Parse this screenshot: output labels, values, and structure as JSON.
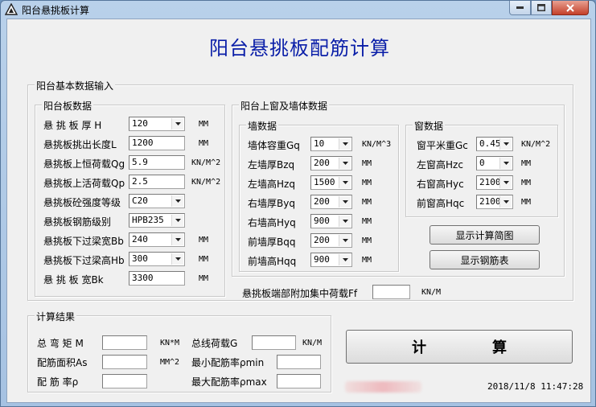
{
  "window": {
    "title": "阳台悬挑板计算"
  },
  "main_title": "阳台悬挑板配筋计算",
  "basic_group": {
    "legend": "阳台基本数据输入",
    "slab": {
      "legend": "阳台板数据",
      "rows": [
        {
          "label": "悬 挑 板 厚 H",
          "value": "120",
          "combo": true,
          "unit": "MM"
        },
        {
          "label": "悬挑板挑出长度L",
          "value": "1200",
          "combo": false,
          "unit": "MM"
        },
        {
          "label": "悬挑板上恒荷载Qg",
          "value": "5.9",
          "combo": false,
          "unit": "KN/M^2"
        },
        {
          "label": "悬挑板上活荷载Qp",
          "value": "2.5",
          "combo": false,
          "unit": "KN/M^2"
        },
        {
          "label": "悬挑板砼强度等级",
          "value": "C20",
          "combo": true,
          "unit": ""
        },
        {
          "label": "悬挑板钢筋级别",
          "value": "HPB235",
          "combo": true,
          "unit": ""
        },
        {
          "label": "悬挑板下过梁宽Bb",
          "value": "240",
          "combo": true,
          "unit": "MM"
        },
        {
          "label": "悬挑板下过梁高Hb",
          "value": "300",
          "combo": true,
          "unit": "MM"
        },
        {
          "label": "悬 挑 板 宽Bk",
          "value": "3300",
          "combo": false,
          "unit": "MM"
        }
      ]
    },
    "upper": {
      "legend": "阳台上窗及墙体数据",
      "wall": {
        "legend": "墙数据",
        "rows": [
          {
            "label": "墙体容重Gq",
            "value": "10",
            "unit": "KN/M^3"
          },
          {
            "label": "左墙厚Bzq",
            "value": "200",
            "unit": "MM"
          },
          {
            "label": "左墙高Hzq",
            "value": "1500",
            "unit": "MM"
          },
          {
            "label": "右墙厚Byq",
            "value": "200",
            "unit": "MM"
          },
          {
            "label": "右墙高Hyq",
            "value": "900",
            "unit": "MM"
          },
          {
            "label": "前墙厚Bqq",
            "value": "200",
            "unit": "MM"
          },
          {
            "label": "前墙高Hqq",
            "value": "900",
            "unit": "MM"
          }
        ]
      },
      "window": {
        "legend": "窗数据",
        "rows": [
          {
            "label": "窗平米重Gc",
            "value": "0.45",
            "unit": "KN/M^2"
          },
          {
            "label": "左窗高Hzc",
            "value": "0",
            "unit": "MM"
          },
          {
            "label": "右窗高Hyc",
            "value": "2100",
            "unit": "MM"
          },
          {
            "label": "前窗高Hqc",
            "value": "2100",
            "unit": "MM"
          }
        ]
      },
      "show_diagram_button": "显示计算简图",
      "show_rebar_button": "显示钢筋表"
    },
    "end_load": {
      "label": "悬挑板端部附加集中荷载Ff",
      "value": "",
      "unit": "KN/M"
    }
  },
  "results": {
    "legend": "计算结果",
    "moment": {
      "label": "总 弯 矩 M",
      "value": "",
      "unit": "KN*M"
    },
    "area": {
      "label": "配筋面积As",
      "value": "",
      "unit": "MM^2"
    },
    "ratio": {
      "label": "配 筋 率ρ",
      "value": ""
    },
    "line_load": {
      "label": "总线荷载G",
      "value": "",
      "unit": "KN/M"
    },
    "min_ratio": {
      "label": "最小配筋率ρmin",
      "value": ""
    },
    "max_ratio": {
      "label": "最大配筋率ρmax",
      "value": ""
    }
  },
  "calc_button": {
    "char1": "计",
    "char2": "算"
  },
  "status": {
    "datetime": "2018/11/8 11:47:28"
  }
}
